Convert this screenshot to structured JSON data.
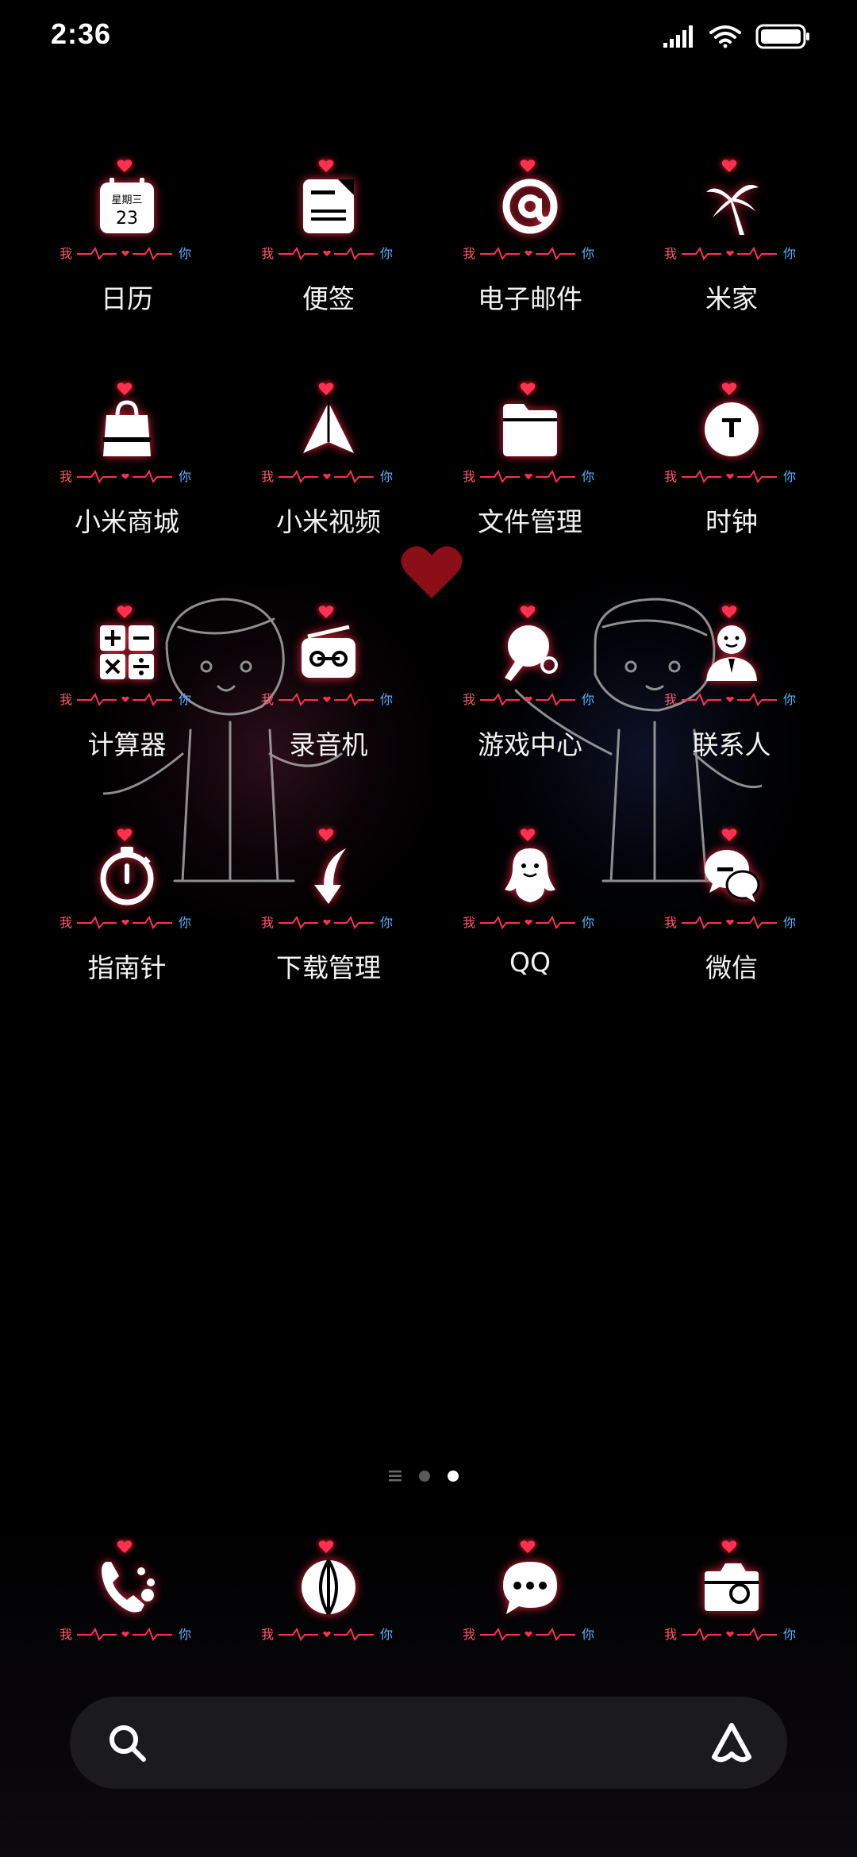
{
  "status_bar": {
    "time": "2:36",
    "icons": [
      "signal-icon",
      "wifi-icon",
      "battery-icon"
    ]
  },
  "badge_text": {
    "me": "我",
    "you": "你"
  },
  "apps": [
    {
      "label": "日历",
      "icon": "calendar-icon",
      "calendar_weekday": "星期三",
      "calendar_day": "23"
    },
    {
      "label": "便签",
      "icon": "notes-icon"
    },
    {
      "label": "电子邮件",
      "icon": "email-at-icon"
    },
    {
      "label": "米家",
      "icon": "palm-tree-icon"
    },
    {
      "label": "小米商城",
      "icon": "shopping-bag-icon"
    },
    {
      "label": "小米视频",
      "icon": "paper-plane-icon"
    },
    {
      "label": "文件管理",
      "icon": "folder-icon"
    },
    {
      "label": "时钟",
      "icon": "clock-icon"
    },
    {
      "label": "计算器",
      "icon": "calculator-icon"
    },
    {
      "label": "录音机",
      "icon": "recorder-icon"
    },
    {
      "label": "游戏中心",
      "icon": "ping-pong-icon"
    },
    {
      "label": "联系人",
      "icon": "contact-person-icon"
    },
    {
      "label": "指南针",
      "icon": "stopwatch-icon"
    },
    {
      "label": "下载管理",
      "icon": "download-arrow-icon"
    },
    {
      "label": "QQ",
      "icon": "qq-penguin-icon"
    },
    {
      "label": "微信",
      "icon": "wechat-icon"
    }
  ],
  "page_indicator": {
    "pages": 3,
    "active": 3
  },
  "dock": [
    {
      "name": "phone",
      "icon": "phone-icon"
    },
    {
      "name": "browser",
      "icon": "globe-icon"
    },
    {
      "name": "messages",
      "icon": "message-bubble-icon"
    },
    {
      "name": "camera",
      "icon": "camera-icon"
    }
  ],
  "search_bar": {
    "left_icon": "search-icon",
    "right_icon": "assistant-icon"
  },
  "colors": {
    "glow": "#ff2a4a",
    "you_badge": "#3aa0ff",
    "background": "#000000"
  }
}
